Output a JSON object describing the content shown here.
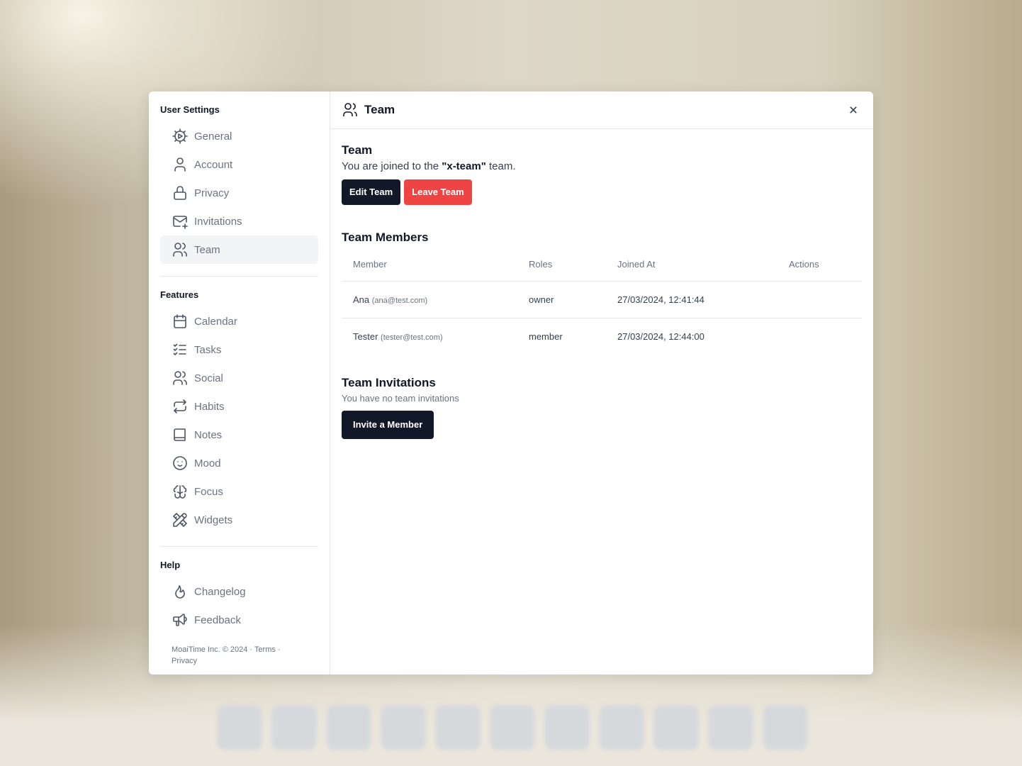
{
  "sidebar": {
    "user_settings_title": "User Settings",
    "user_items": [
      {
        "label": "General",
        "icon": "gear-icon"
      },
      {
        "label": "Account",
        "icon": "user-icon"
      },
      {
        "label": "Privacy",
        "icon": "lock-icon"
      },
      {
        "label": "Invitations",
        "icon": "mail-plus-icon"
      },
      {
        "label": "Team",
        "icon": "users-icon",
        "active": true
      }
    ],
    "features_title": "Features",
    "feature_items": [
      {
        "label": "Calendar",
        "icon": "calendar-icon"
      },
      {
        "label": "Tasks",
        "icon": "list-check-icon"
      },
      {
        "label": "Social",
        "icon": "users-icon"
      },
      {
        "label": "Habits",
        "icon": "repeat-icon"
      },
      {
        "label": "Notes",
        "icon": "book-icon"
      },
      {
        "label": "Mood",
        "icon": "smile-icon"
      },
      {
        "label": "Focus",
        "icon": "brain-icon"
      },
      {
        "label": "Widgets",
        "icon": "tools-icon"
      }
    ],
    "help_title": "Help",
    "help_items": [
      {
        "label": "Changelog",
        "icon": "flame-icon"
      },
      {
        "label": "Feedback",
        "icon": "megaphone-icon"
      }
    ],
    "footer": {
      "copyright": "MoaiTime Inc. © 2024 · ",
      "terms": "Terms",
      "sep": " · ",
      "privacy": "Privacy"
    }
  },
  "header": {
    "title": "Team"
  },
  "team": {
    "title": "Team",
    "text_before": "You are joined to the ",
    "team_name": "\"x-team\"",
    "text_after": " team.",
    "edit_label": "Edit Team",
    "leave_label": "Leave Team"
  },
  "members": {
    "title": "Team Members",
    "columns": [
      "Member",
      "Roles",
      "Joined At",
      "Actions"
    ],
    "rows": [
      {
        "name": "Ana",
        "email": "(ana@test.com)",
        "role": "owner",
        "joined": "27/03/2024, 12:41:44"
      },
      {
        "name": "Tester",
        "email": "(tester@test.com)",
        "role": "member",
        "joined": "27/03/2024, 12:44:00"
      }
    ]
  },
  "invitations": {
    "title": "Team Invitations",
    "empty_text": "You have no team invitations",
    "invite_label": "Invite a Member"
  },
  "colors": {
    "primary": "#111827",
    "danger": "#ef4444"
  }
}
